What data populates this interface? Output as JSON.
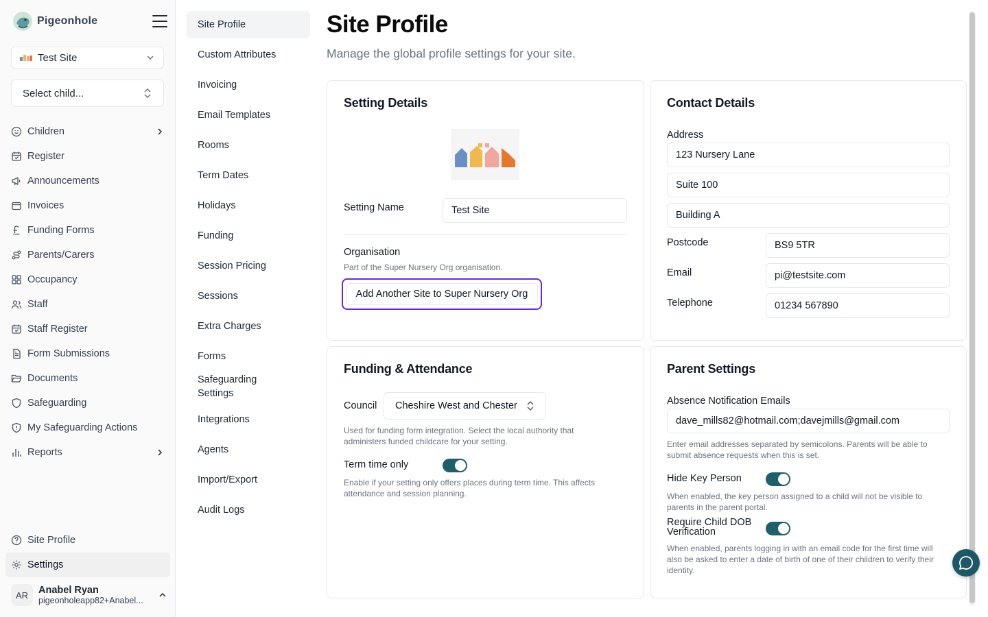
{
  "brand": {
    "name": "Pigeonhole"
  },
  "sidebar": {
    "site_select": "Test Site",
    "child_select_placeholder": "Select child...",
    "nav": [
      {
        "label": "Children",
        "icon": "smile-icon",
        "has_chevron": true
      },
      {
        "label": "Register",
        "icon": "calendar-check-icon"
      },
      {
        "label": "Announcements",
        "icon": "megaphone-icon"
      },
      {
        "label": "Invoices",
        "icon": "wallet-icon"
      },
      {
        "label": "Funding Forms",
        "icon": "pound-icon"
      },
      {
        "label": "Parents/Carers",
        "icon": "route-icon"
      },
      {
        "label": "Occupancy",
        "icon": "grid-icon"
      },
      {
        "label": "Staff",
        "icon": "users-icon"
      },
      {
        "label": "Staff Register",
        "icon": "calendar-check-icon"
      },
      {
        "label": "Form Submissions",
        "icon": "file-text-icon"
      },
      {
        "label": "Documents",
        "icon": "folder-open-icon"
      },
      {
        "label": "Safeguarding",
        "icon": "shield-icon"
      },
      {
        "label": "My Safeguarding Actions",
        "icon": "shield-alert-icon"
      },
      {
        "label": "Reports",
        "icon": "bar-chart-icon",
        "has_chevron": true
      }
    ],
    "bottom_nav": [
      {
        "label": "Site Profile",
        "icon": "help-circle-icon"
      },
      {
        "label": "Settings",
        "icon": "gear-icon"
      }
    ],
    "user": {
      "initials": "AR",
      "name": "Anabel Ryan",
      "email": "pigeonholeapp82+Anabel..."
    }
  },
  "settings_nav": [
    "Site Profile",
    "Custom Attributes",
    "Invoicing",
    "Email Templates",
    "Rooms",
    "Term Dates",
    "Holidays",
    "Funding",
    "Session Pricing",
    "Sessions",
    "Extra Charges",
    "Forms",
    "Safeguarding Settings",
    "Integrations",
    "Agents",
    "Import/Export",
    "Audit Logs"
  ],
  "page": {
    "title": "Site Profile",
    "subtitle": "Manage the global profile settings for your site."
  },
  "setting_details": {
    "heading": "Setting Details",
    "name_label": "Setting Name",
    "name_value": "Test Site",
    "org_label": "Organisation",
    "org_help": "Part of the Super Nursery Org organisation.",
    "add_site_button": "Add Another Site to Super Nursery Org"
  },
  "contact_details": {
    "heading": "Contact Details",
    "address_label": "Address",
    "address_lines": [
      "123 Nursery Lane",
      "Suite 100",
      "Building A"
    ],
    "postcode_label": "Postcode",
    "postcode": "BS9 5TR",
    "email_label": "Email",
    "email": "pi@testsite.com",
    "telephone_label": "Telephone",
    "telephone": "01234 567890"
  },
  "funding": {
    "heading": "Funding & Attendance",
    "council_label": "Council",
    "council_value": "Cheshire West and Chester",
    "council_help": "Used for funding form integration. Select the local authority that administers funded childcare for your setting.",
    "term_label": "Term time only",
    "term_on": true,
    "term_help": "Enable if your setting only offers places during term time. This affects attendance and session planning."
  },
  "parent_settings": {
    "heading": "Parent Settings",
    "absence_label": "Absence Notification Emails",
    "absence_value": "dave_mills82@hotmail.com;davejmills@gmail.com",
    "absence_help": "Enter email addresses separated by semicolons. Parents will be able to submit absence requests when this is set.",
    "hide_key_label": "Hide Key Person",
    "hide_key_on": true,
    "hide_key_help": "When enabled, the key person assigned to a child will not be visible to parents in the parent portal.",
    "dob_label": "Require Child DOB Verification",
    "dob_on": true,
    "dob_help": "When enabled, parents logging in with an email code for the first time will also be asked to enter a date of birth of one of their children to verify their identity."
  },
  "colors": {
    "accent": "#1f5f6b",
    "focus": "#6d28d9"
  }
}
